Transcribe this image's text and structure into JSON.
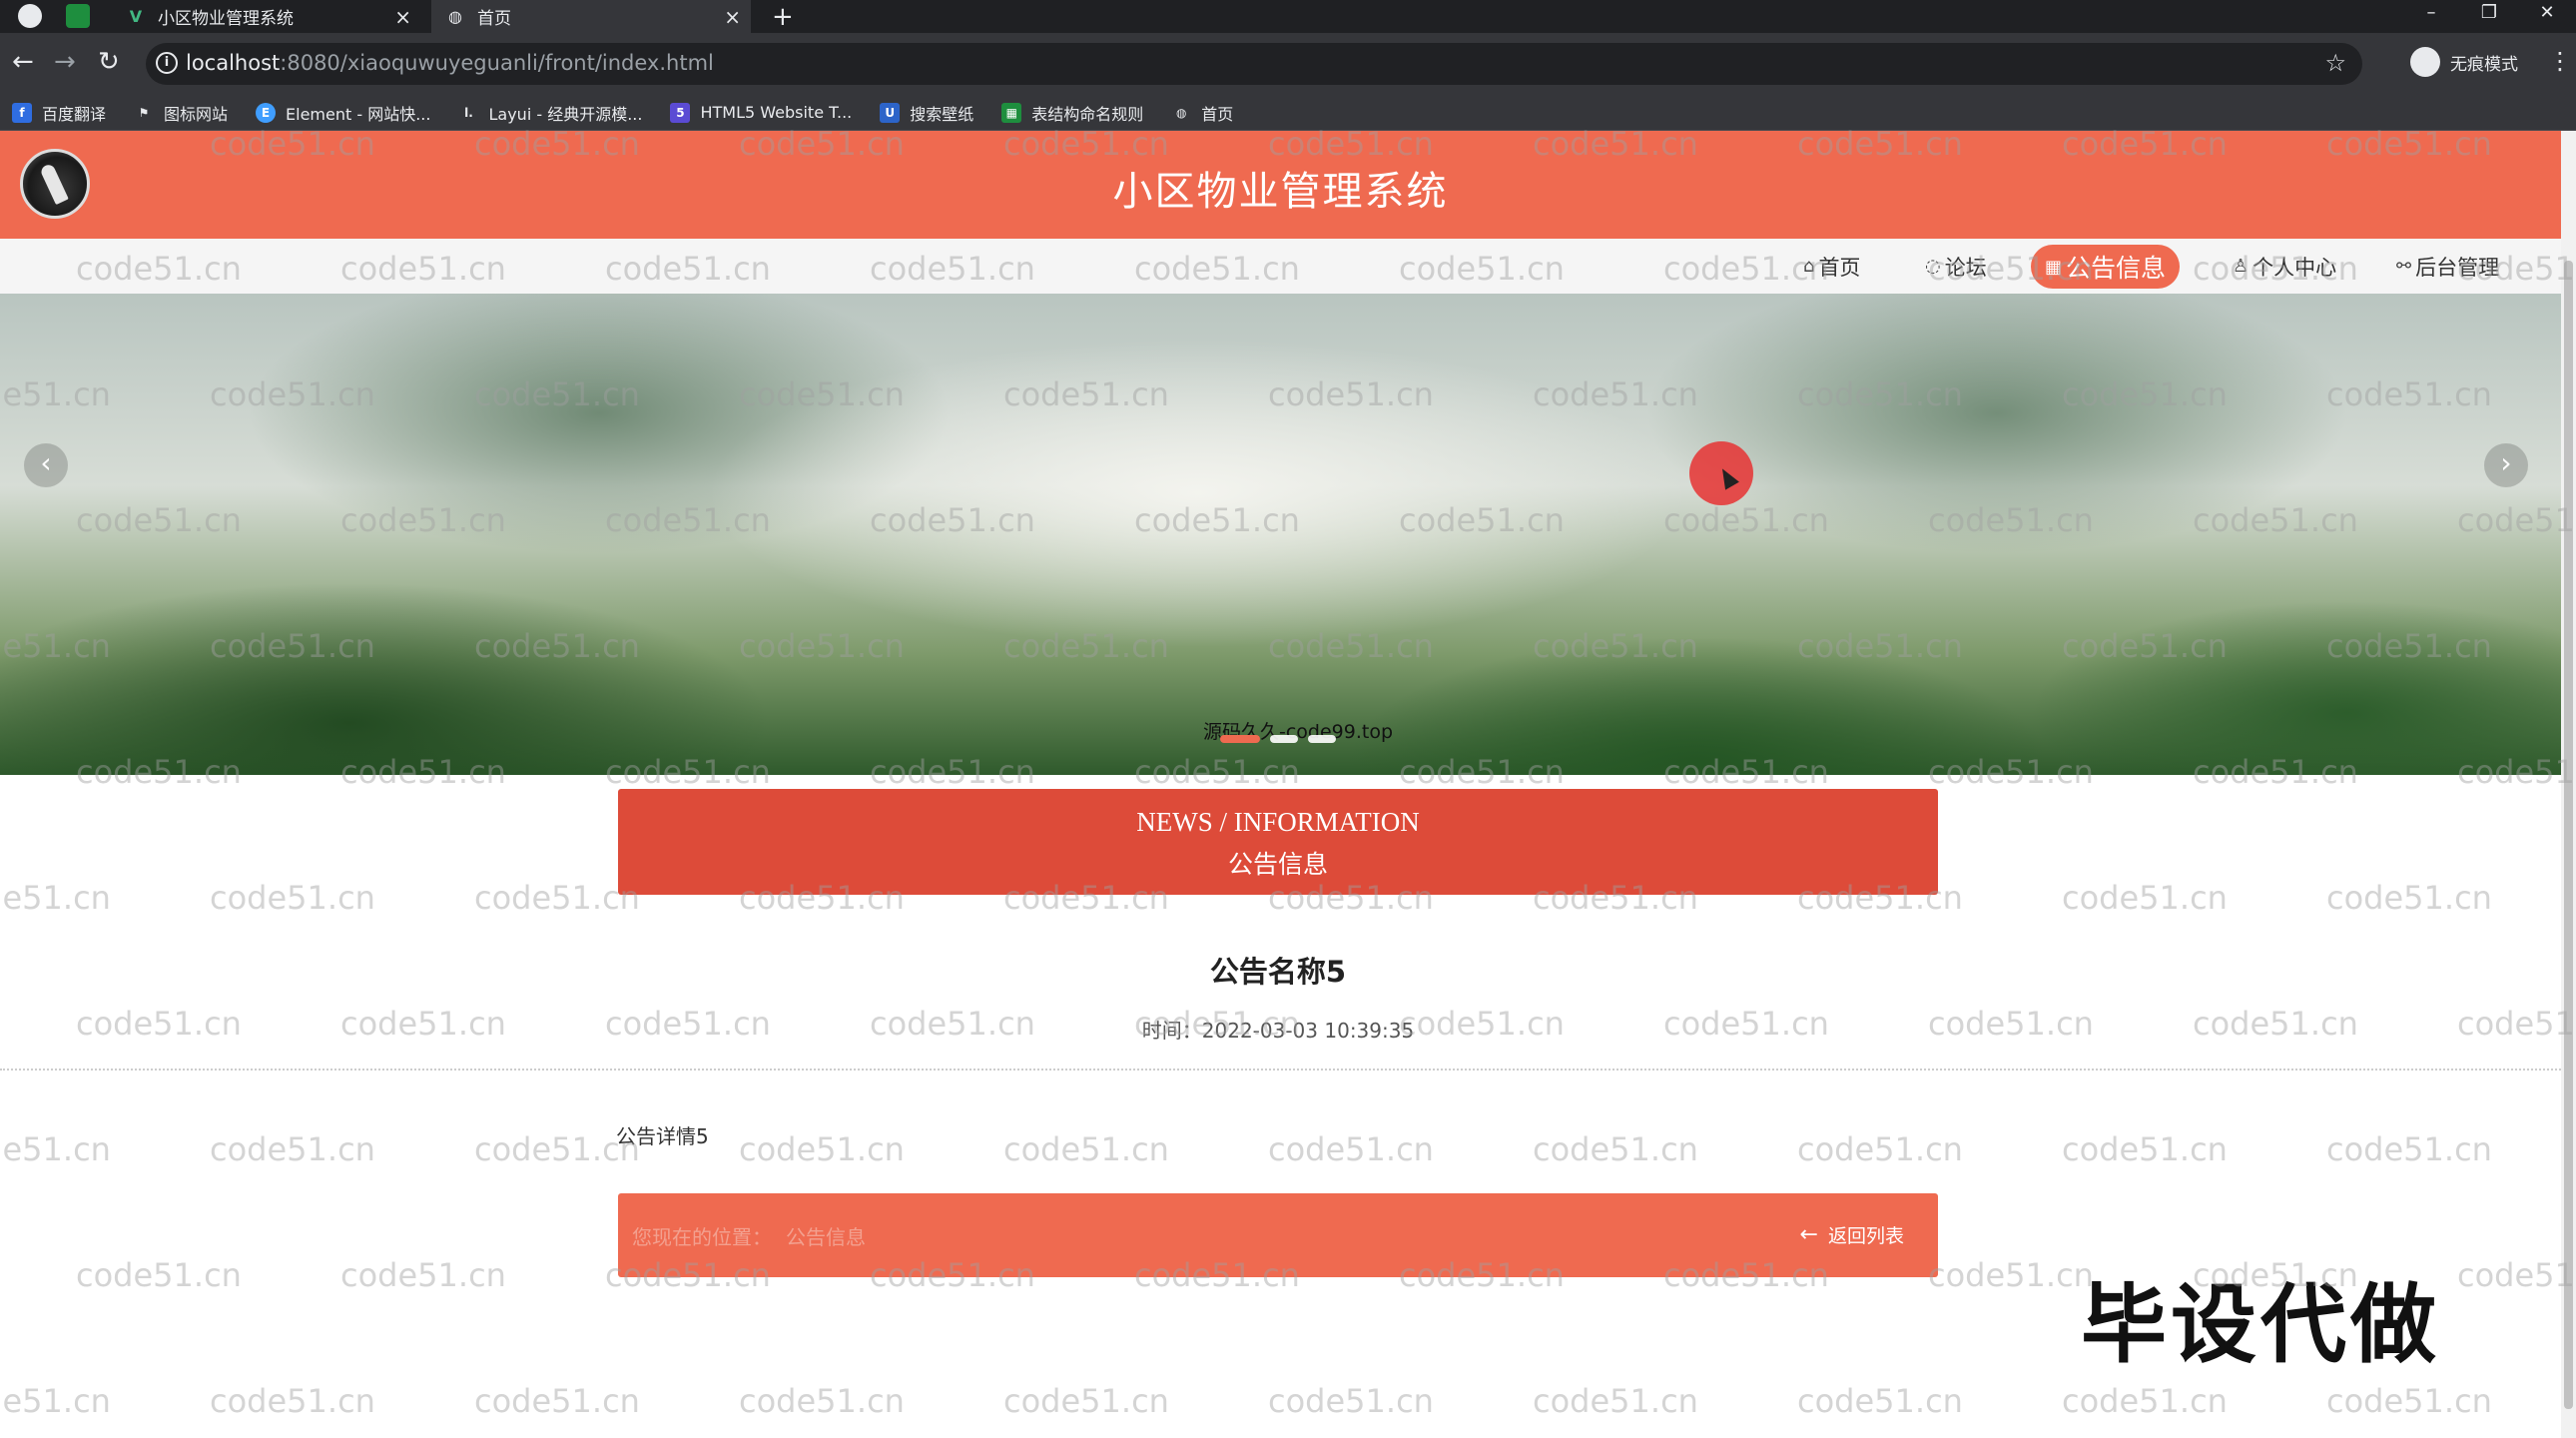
{
  "browser": {
    "tabs": [
      {
        "title": "小区物业管理系统",
        "active": false
      },
      {
        "title": "首页",
        "active": true
      }
    ],
    "url_host": "localhost",
    "url_path": ":8080/xiaoquwuyeguanli/front/index.html",
    "incognito_label": "无痕模式",
    "bookmarks": [
      {
        "label": "百度翻译",
        "icon": "translate-icon",
        "color": "#2f6de1"
      },
      {
        "label": "图标网站",
        "icon": "flag-icon",
        "color": "#444444"
      },
      {
        "label": "Element - 网站快...",
        "icon": "element-icon",
        "color": "#409eff"
      },
      {
        "label": "Layui - 经典开源模...",
        "icon": "layui-icon",
        "color": "#555555"
      },
      {
        "label": "HTML5 Website T...",
        "icon": "html5-icon",
        "color": "#5b4bd4"
      },
      {
        "label": "搜索壁纸",
        "icon": "wallpaper-icon",
        "color": "#2c64c9"
      },
      {
        "label": "表结构命名规则",
        "icon": "sheet-icon",
        "color": "#1e8e3e"
      },
      {
        "label": "首页",
        "icon": "globe-icon",
        "color": "#777777"
      }
    ]
  },
  "site": {
    "title": "小区物业管理系统",
    "header_color": "#ef6a50"
  },
  "nav": {
    "items": [
      {
        "label": "首页",
        "icon": "home-icon"
      },
      {
        "label": "论坛",
        "icon": "chat-icon"
      },
      {
        "label": "公告信息",
        "icon": "grid-icon",
        "active": true
      },
      {
        "label": "个人中心",
        "icon": "user-icon"
      },
      {
        "label": "后台管理",
        "icon": "link-icon"
      }
    ]
  },
  "banner": {
    "caption": "源码久久-code99.top",
    "slide_count": 3,
    "active_slide": 0
  },
  "section": {
    "en": "NEWS / INFORMATION",
    "zh": "公告信息",
    "color": "#dd4b39"
  },
  "article": {
    "title": "公告名称5",
    "meta": "时间：2022-03-03 10:39:35",
    "body": "公告详情5"
  },
  "footer": {
    "links": [
      "您现在的位置：",
      "公告信息"
    ],
    "back_label": "返回列表"
  },
  "stamp": "毕设代做",
  "watermark": "code51.cn"
}
